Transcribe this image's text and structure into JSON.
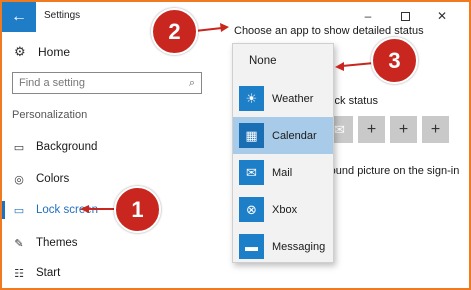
{
  "window": {
    "title": "Settings",
    "back_icon": "back-arrow-icon",
    "minimize": "–",
    "close": "✕"
  },
  "sidebar": {
    "home_label": "Home",
    "search_placeholder": "Find a setting",
    "section_label": "Personalization",
    "items": [
      {
        "label": "Background",
        "icon": "image-icon"
      },
      {
        "label": "Colors",
        "icon": "palette-icon"
      },
      {
        "label": "Lock screen",
        "icon": "lock-screen-icon",
        "active": true
      },
      {
        "label": "Themes",
        "icon": "brush-icon"
      },
      {
        "label": "Start",
        "icon": "start-icon"
      }
    ]
  },
  "main": {
    "heading": "Choose an app to show detailed status",
    "quick_status_fragment": "uick status",
    "signin_fragment": "round picture on the sign-in",
    "tiles": [
      "+",
      "+",
      "+"
    ]
  },
  "dropdown": {
    "none_label": "None",
    "options": [
      {
        "label": "Weather",
        "icon": "weather-sun-icon"
      },
      {
        "label": "Calendar",
        "icon": "calendar-icon",
        "selected": true
      },
      {
        "label": "Mail",
        "icon": "mail-icon"
      },
      {
        "label": "Xbox",
        "icon": "xbox-icon"
      },
      {
        "label": "Messaging",
        "icon": "messaging-icon"
      }
    ]
  },
  "callouts": {
    "one": "1",
    "two": "2",
    "three": "3"
  },
  "colors": {
    "accent": "#1f6fc0",
    "callout": "#c9261f",
    "frame": "#f07a1f",
    "selected": "#a8cbe9"
  }
}
